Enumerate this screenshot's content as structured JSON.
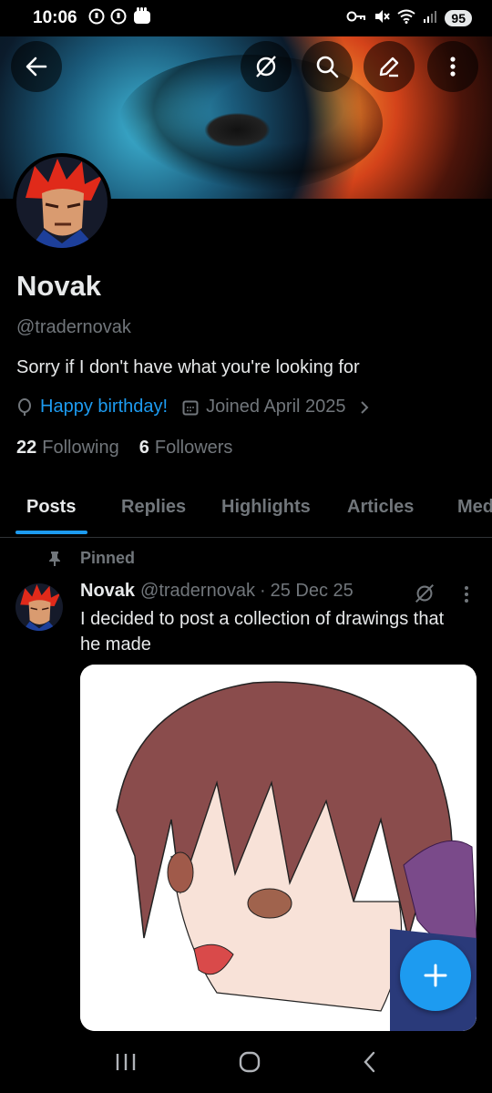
{
  "status_bar": {
    "time": "10:06",
    "battery": "95"
  },
  "profile": {
    "name": "Novak",
    "handle": "@tradernovak",
    "bio": "Sorry if I don't have what you're looking for",
    "birthday": "Happy birthday!",
    "joined": "Joined April 2025",
    "following_count": "22",
    "following_label": "Following",
    "followers_count": "6",
    "followers_label": "Followers"
  },
  "tabs": [
    {
      "label": "Posts",
      "active": true
    },
    {
      "label": "Replies"
    },
    {
      "label": "Highlights"
    },
    {
      "label": "Articles"
    },
    {
      "label": "Media"
    }
  ],
  "pinned_post": {
    "pinned_label": "Pinned",
    "author": "Novak",
    "handle": "@tradernovak",
    "sep": "·",
    "date": "25 Dec 25",
    "text": "I decided to post a collection of drawings that he made"
  },
  "colors": {
    "accent": "#1d9bf0",
    "muted": "#71767b",
    "text": "#e7e9ea",
    "bg": "#000000"
  },
  "icons": {
    "back": "arrow-left-icon",
    "grok": "grok-icon",
    "search": "search-icon",
    "edit": "pen-icon",
    "more": "more-vertical-icon",
    "compose": "plus-icon"
  }
}
